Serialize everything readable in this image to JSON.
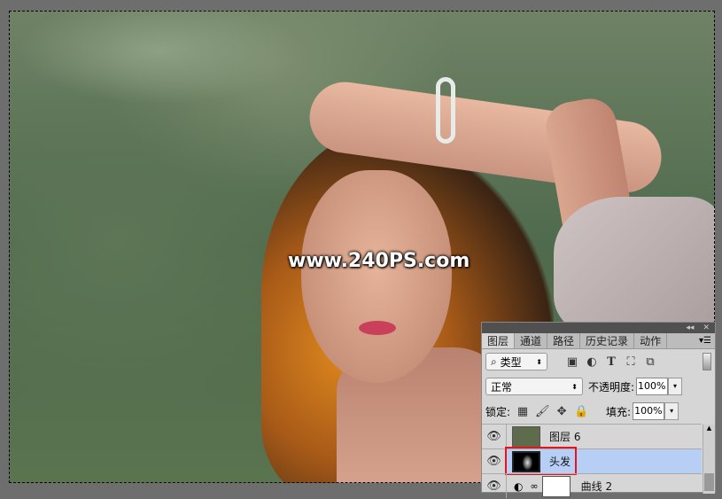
{
  "canvas": {
    "watermark": "www.240PS.com"
  },
  "panel": {
    "tabs": [
      "图层",
      "通道",
      "路径",
      "历史记录",
      "动作"
    ],
    "active_tab": "图层",
    "filter": {
      "label": "类型",
      "icons": [
        "image-filter-icon",
        "adjustment-filter-icon",
        "type-filter-icon",
        "shape-filter-icon",
        "smart-object-filter-icon"
      ]
    },
    "blend_mode": "正常",
    "opacity_label": "不透明度:",
    "opacity": "100%",
    "lock_label": "锁定:",
    "fill_label": "填充:",
    "fill": "100%",
    "layers": [
      {
        "name": "图层 6",
        "thumb_color": "#5e6b4c",
        "selected": false
      },
      {
        "name": "头发",
        "selected": true
      },
      {
        "name": "曲线 2",
        "selected": false
      }
    ]
  },
  "colors": {
    "selected_layer": "#b8cff5",
    "highlight_box": "#e8141c"
  }
}
